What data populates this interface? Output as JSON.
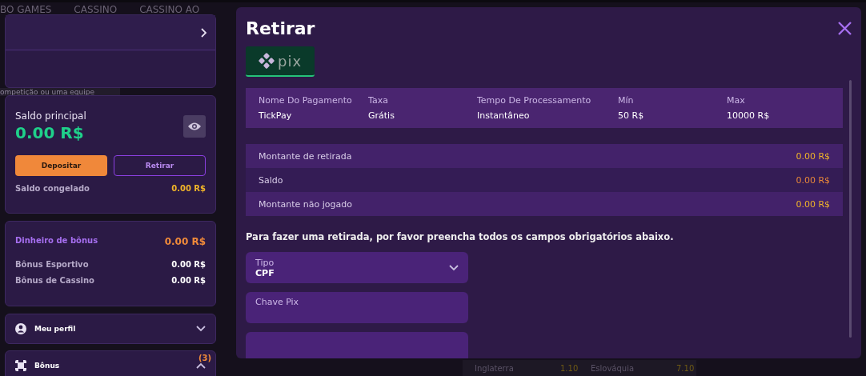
{
  "background": {
    "nav": [
      "BO GAMES",
      "CASSINO",
      "CASSINO AO"
    ],
    "search_placeholder": "ompetição ou uma equipe",
    "match_row": [
      "Inglaterra",
      "1.10",
      "Eslováquia",
      "7.10"
    ]
  },
  "sidebar": {
    "balance": {
      "label": "Saldo principal",
      "amount": "0.00 R$",
      "buttons": [
        "Depositar",
        "Retirar"
      ],
      "frozen_label": "Saldo congelado",
      "frozen_value": "0.00 R$"
    },
    "bonus": {
      "title": "Dinheiro de bônus",
      "value": "0.00 R$",
      "items": [
        {
          "label": "Bônus Esportivo",
          "value": "0.00 R$"
        },
        {
          "label": "Bônus de Cassino",
          "value": "0.00 R$"
        }
      ]
    },
    "menu": [
      {
        "kind": "profile",
        "label": "Meu perfil",
        "expanded": false
      },
      {
        "kind": "bonus",
        "label": "Bônus",
        "expanded": true,
        "badge": "(3)"
      }
    ]
  },
  "modal": {
    "title": "Retirar",
    "method": {
      "logo_text": "pix",
      "selected": true
    },
    "info": [
      {
        "header": "Nome Do Pagamento",
        "value": "TickPay"
      },
      {
        "header": "Taxa",
        "value": "Grátis"
      },
      {
        "header": "Tempo De Processamento",
        "value": "Instantâneo"
      },
      {
        "header": "Mín",
        "value": "50 R$"
      },
      {
        "header": "Max",
        "value": "10000 R$"
      }
    ],
    "amounts": [
      {
        "label": "Montante de retirada",
        "value": "0.00 R$",
        "color": "#f0b429"
      },
      {
        "label": "Saldo",
        "value": "0.00 R$",
        "color": "#e8873a"
      },
      {
        "label": "Montante não jogado",
        "value": "0.00 R$",
        "color": "#f0b429"
      }
    ],
    "notice": "Para fazer uma retirada, por favor preencha todos os campos obrigatórios abaixo.",
    "fields": [
      {
        "kind": "select",
        "label": "Tipo",
        "value": "CPF"
      },
      {
        "kind": "input",
        "placeholder": "Chave Pix"
      },
      {
        "kind": "input"
      }
    ]
  }
}
